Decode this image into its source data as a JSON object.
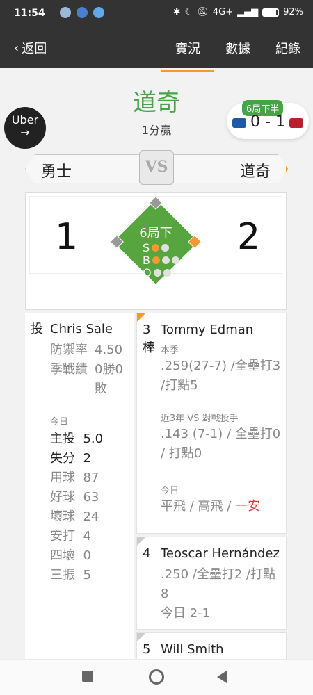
{
  "status_bar": {
    "time": "11:54",
    "network": "4G+",
    "battery": "92%"
  },
  "nav": {
    "back_label": "返回",
    "tabs": [
      {
        "label": "實況",
        "active": true
      },
      {
        "label": "數據",
        "active": false
      },
      {
        "label": "紀錄",
        "active": false
      }
    ]
  },
  "game": {
    "winner": "道奇",
    "margin": "1分贏",
    "inning_badge": "6局下半",
    "score_text": "0 - 1",
    "away_team": "勇士",
    "vs": "VS",
    "home_team": "道奇",
    "away_score": "1",
    "home_score": "2",
    "inning": "6局下",
    "count": {
      "strikes_label": "S",
      "balls_label": "B",
      "outs_label": "O",
      "strikes": 1,
      "balls": 1,
      "outs": 0
    }
  },
  "sponsor": {
    "label": "Uber",
    "arrow": "→"
  },
  "pitcher": {
    "role": "投",
    "name": "Chris Sale",
    "era_label": "防禦率",
    "era": "4.50",
    "record_label": "季戰績",
    "record": "0勝0敗",
    "today_label": "今日",
    "stats": [
      {
        "label": "主投",
        "value": "5.0"
      },
      {
        "label": "失分",
        "value": "2"
      },
      {
        "label": "用球",
        "value": "87"
      },
      {
        "label": "好球",
        "value": "63"
      },
      {
        "label": "壞球",
        "value": "24"
      },
      {
        "label": "安打",
        "value": "4"
      },
      {
        "label": "四壞",
        "value": "0"
      },
      {
        "label": "三振",
        "value": "5"
      }
    ]
  },
  "batters": [
    {
      "order": "3",
      "role": "棒",
      "name": "Tommy Edman",
      "season_label": "本季",
      "season_stats": ".259(27-7) /全壘打3 /打點5",
      "vs_label": "近3年 VS 對戰投手",
      "vs_stats": ".143 (7-1) / 全壘打0 / 打點0",
      "today_label": "今日",
      "today_1": "平飛",
      "today_2": "高飛",
      "today_3": "一安"
    },
    {
      "order": "4",
      "name": "Teoscar Hernández",
      "stats": ".250 /全壘打2 /打點8",
      "today": "今日 2-1"
    },
    {
      "order": "5",
      "name": "Will Smith"
    }
  ],
  "colors": {
    "accent": "#f29a2e",
    "green": "#4aa14a",
    "field": "#56a53f",
    "header": "#333333"
  }
}
